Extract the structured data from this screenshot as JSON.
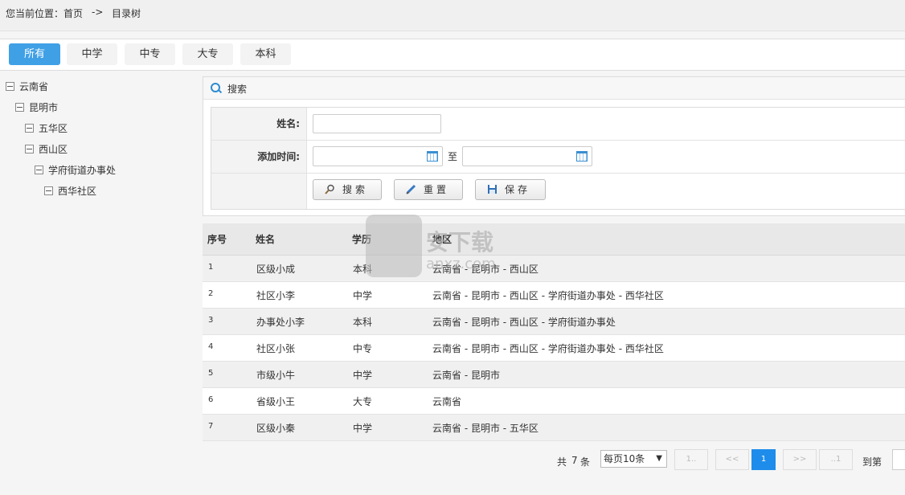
{
  "breadcrumb": {
    "label": "您当前位置：",
    "home": "首页",
    "arrow": "->",
    "current": "目录树"
  },
  "tabs": [
    {
      "label": "所有",
      "active": true
    },
    {
      "label": "中学"
    },
    {
      "label": "中专"
    },
    {
      "label": "大专"
    },
    {
      "label": "本科"
    }
  ],
  "tree": [
    "云南省",
    "昆明市",
    "五华区",
    "西山区",
    "学府街道办事处",
    "西华社区"
  ],
  "search": {
    "title": "搜索",
    "name_label": "姓名:",
    "name_value": "",
    "date_label": "添加时间:",
    "date_from": "",
    "date_to_sep": "至",
    "date_to": "",
    "btn_search": "搜索",
    "btn_reset": "重置",
    "btn_save": "保存"
  },
  "table": {
    "headers": [
      "序号",
      "姓名",
      "学历",
      "地区"
    ],
    "rows": [
      [
        "1",
        "区级小成",
        "本科",
        "云南省 - 昆明市 - 西山区"
      ],
      [
        "2",
        "社区小李",
        "中学",
        "云南省 - 昆明市 - 西山区 - 学府街道办事处 - 西华社区"
      ],
      [
        "3",
        "办事处小李",
        "本科",
        "云南省 - 昆明市 - 西山区 - 学府街道办事处"
      ],
      [
        "4",
        "社区小张",
        "中专",
        "云南省 - 昆明市 - 西山区 - 学府街道办事处 - 西华社区"
      ],
      [
        "5",
        "市级小牛",
        "中学",
        "云南省 - 昆明市"
      ],
      [
        "6",
        "省级小王",
        "大专",
        "云南省"
      ],
      [
        "7",
        "区级小秦",
        "中学",
        "云南省 - 昆明市 - 五华区"
      ]
    ]
  },
  "pager": {
    "total_prefix": "共",
    "total": "7",
    "total_suffix": "条",
    "per_page": "每页10条",
    "first": "1..",
    "prev": "<<",
    "current": "1",
    "next": ">>",
    "last": "..1",
    "goto_label": "到第"
  },
  "watermark": {
    "text": "安下载",
    "sub": "anxz.com"
  }
}
